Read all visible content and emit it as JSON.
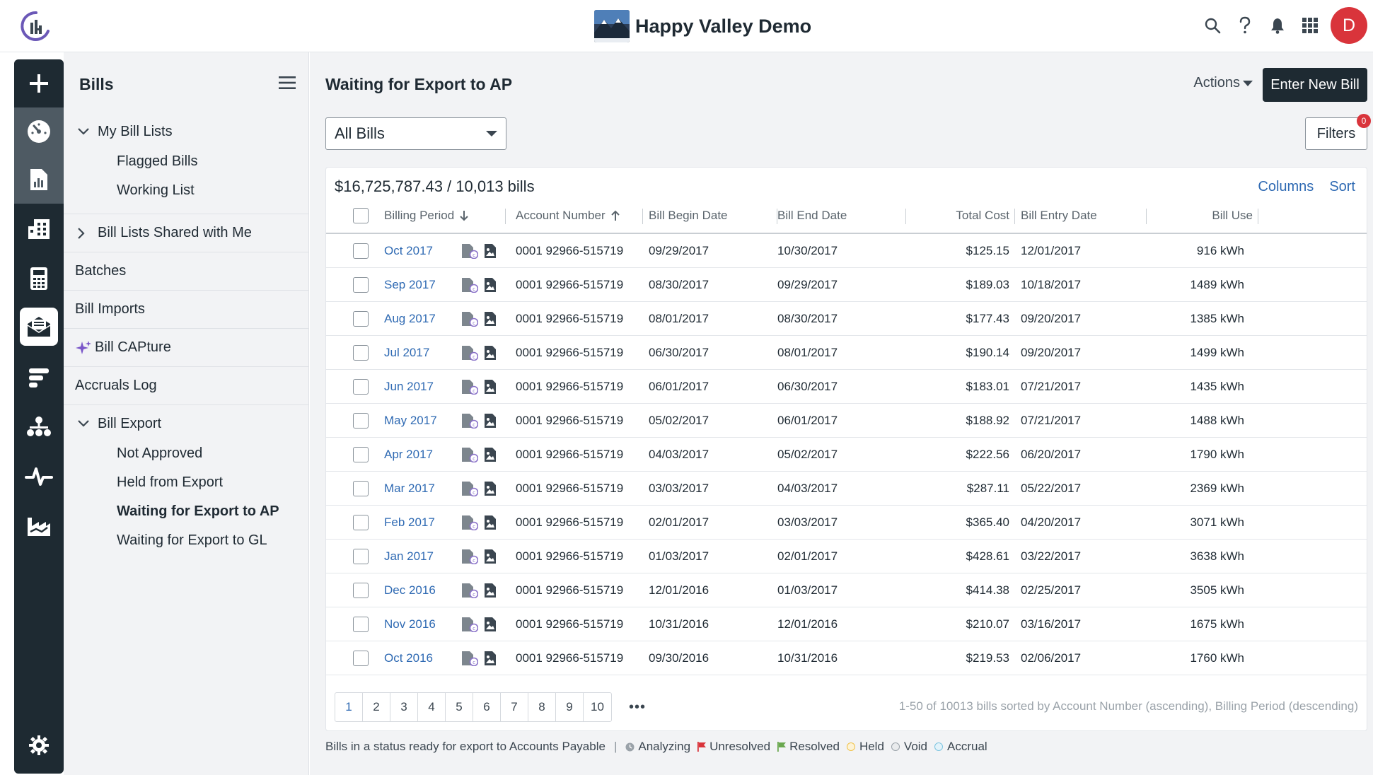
{
  "header": {
    "org_name": "Happy Valley Demo",
    "avatar_initial": "D"
  },
  "nav": {
    "title": "Bills",
    "my_bill_lists": "My Bill Lists",
    "flagged_bills": "Flagged Bills",
    "working_list": "Working List",
    "shared_lists": "Bill Lists Shared with Me",
    "batches": "Batches",
    "bill_imports": "Bill Imports",
    "bill_capture": "Bill CAPture",
    "accruals_log": "Accruals Log",
    "bill_export": "Bill Export",
    "not_approved": "Not Approved",
    "held_from_export": "Held from Export",
    "waiting_ap": "Waiting for Export to AP",
    "waiting_gl": "Waiting for Export to GL"
  },
  "main": {
    "title": "Waiting for Export to AP",
    "actions_label": "Actions",
    "enter_new_bill": "Enter New Bill",
    "select_value": "All Bills",
    "filters_label": "Filters",
    "filters_count": "0",
    "summary": "$16,725,787.43 / 10,013 bills",
    "columns_link": "Columns",
    "sort_link": "Sort"
  },
  "table": {
    "headers": {
      "billing_period": "Billing Period",
      "account_number": "Account Number",
      "bill_begin_date": "Bill Begin Date",
      "bill_end_date": "Bill End Date",
      "total_cost": "Total Cost",
      "bill_entry_date": "Bill Entry Date",
      "bill_use": "Bill Use"
    },
    "rows": [
      {
        "period": "Oct 2017",
        "account": "0001 92966-515719",
        "begin": "09/29/2017",
        "end": "10/30/2017",
        "cost": "$125.15",
        "entry": "12/01/2017",
        "use": "916 kWh"
      },
      {
        "period": "Sep 2017",
        "account": "0001 92966-515719",
        "begin": "08/30/2017",
        "end": "09/29/2017",
        "cost": "$189.03",
        "entry": "10/18/2017",
        "use": "1489 kWh"
      },
      {
        "period": "Aug 2017",
        "account": "0001 92966-515719",
        "begin": "08/01/2017",
        "end": "08/30/2017",
        "cost": "$177.43",
        "entry": "09/20/2017",
        "use": "1385 kWh"
      },
      {
        "period": "Jul 2017",
        "account": "0001 92966-515719",
        "begin": "06/30/2017",
        "end": "08/01/2017",
        "cost": "$190.14",
        "entry": "09/20/2017",
        "use": "1499 kWh"
      },
      {
        "period": "Jun 2017",
        "account": "0001 92966-515719",
        "begin": "06/01/2017",
        "end": "06/30/2017",
        "cost": "$183.01",
        "entry": "07/21/2017",
        "use": "1435 kWh"
      },
      {
        "period": "May 2017",
        "account": "0001 92966-515719",
        "begin": "05/02/2017",
        "end": "06/01/2017",
        "cost": "$188.92",
        "entry": "07/21/2017",
        "use": "1488 kWh"
      },
      {
        "period": "Apr 2017",
        "account": "0001 92966-515719",
        "begin": "04/03/2017",
        "end": "05/02/2017",
        "cost": "$222.56",
        "entry": "06/20/2017",
        "use": "1790 kWh"
      },
      {
        "period": "Mar 2017",
        "account": "0001 92966-515719",
        "begin": "03/03/2017",
        "end": "04/03/2017",
        "cost": "$287.11",
        "entry": "05/22/2017",
        "use": "2369 kWh"
      },
      {
        "period": "Feb 2017",
        "account": "0001 92966-515719",
        "begin": "02/01/2017",
        "end": "03/03/2017",
        "cost": "$365.40",
        "entry": "04/20/2017",
        "use": "3071 kWh"
      },
      {
        "period": "Jan 2017",
        "account": "0001 92966-515719",
        "begin": "01/03/2017",
        "end": "02/01/2017",
        "cost": "$428.61",
        "entry": "03/22/2017",
        "use": "3638 kWh"
      },
      {
        "period": "Dec 2016",
        "account": "0001 92966-515719",
        "begin": "12/01/2016",
        "end": "01/03/2017",
        "cost": "$414.38",
        "entry": "02/25/2017",
        "use": "3505 kWh"
      },
      {
        "period": "Nov 2016",
        "account": "0001 92966-515719",
        "begin": "10/31/2016",
        "end": "12/01/2016",
        "cost": "$210.07",
        "entry": "03/16/2017",
        "use": "1675 kWh"
      },
      {
        "period": "Oct 2016",
        "account": "0001 92966-515719",
        "begin": "09/30/2016",
        "end": "10/31/2016",
        "cost": "$219.53",
        "entry": "02/06/2017",
        "use": "1760 kWh"
      }
    ]
  },
  "pagination": {
    "pages": [
      "1",
      "2",
      "3",
      "4",
      "5",
      "6",
      "7",
      "8",
      "9",
      "10"
    ],
    "more": "•••",
    "info": "1-50 of 10013 bills sorted by Account Number (ascending), Billing Period (descending)"
  },
  "legend": {
    "description": "Bills in a status ready for export to Accounts Payable",
    "separator": "|",
    "analyzing": "Analyzing",
    "unresolved": "Unresolved",
    "resolved": "Resolved",
    "held": "Held",
    "void": "Void",
    "accrual": "Accrual"
  },
  "colors": {
    "sidebar": "#1e2a32",
    "accent_link": "#2f6ab3",
    "avatar": "#d9343b",
    "unresolved_flag": "#d9343b",
    "resolved_flag": "#6aa84f",
    "held_dot": "#f0c24a",
    "accrual_dot": "#7cc4e0"
  }
}
